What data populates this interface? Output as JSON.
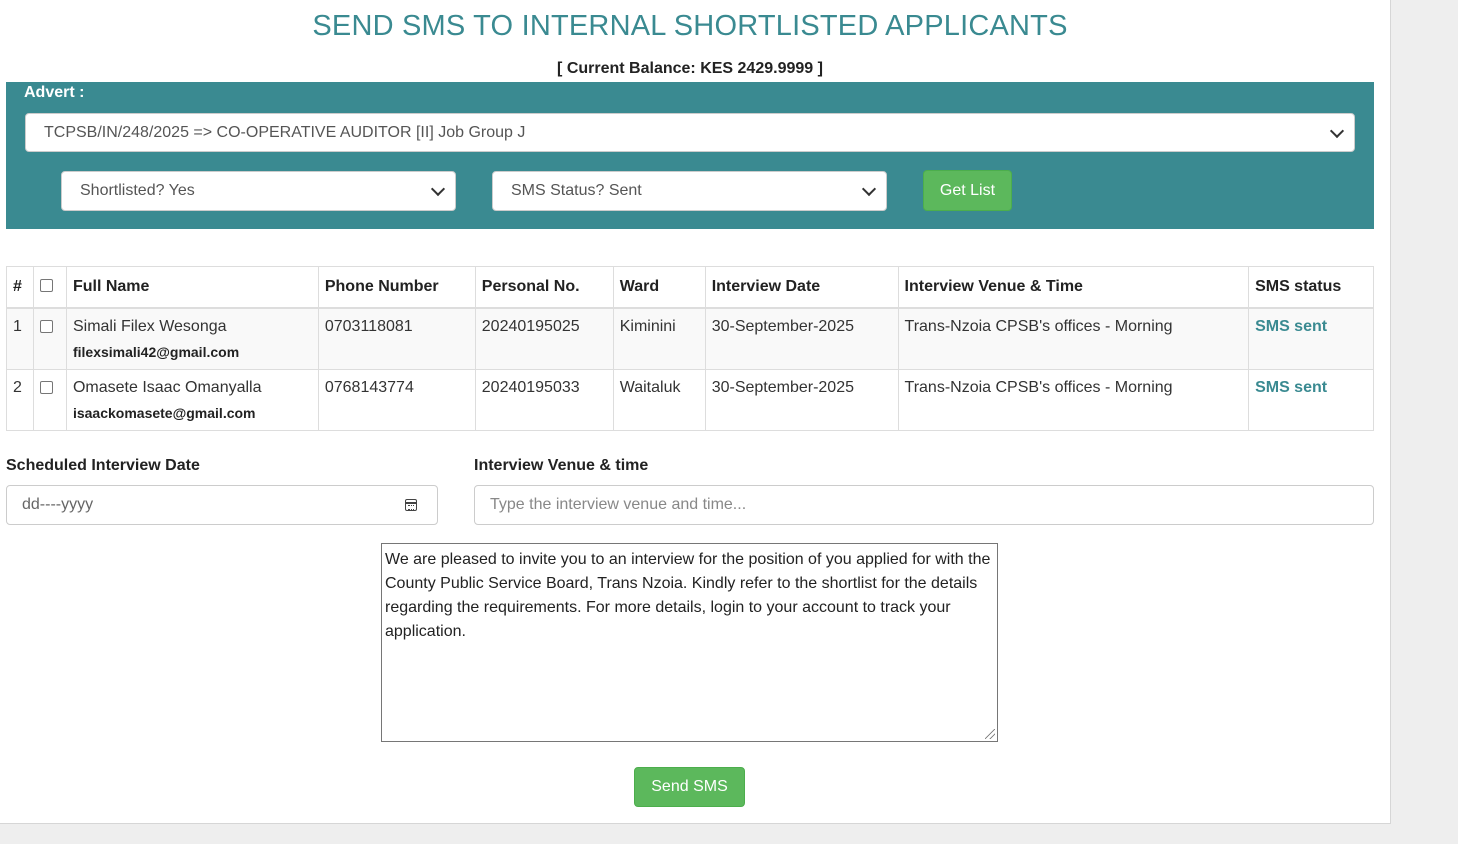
{
  "page": {
    "title": "SEND SMS TO INTERNAL SHORTLISTED APPLICANTS",
    "balance": "[ Current Balance: KES 2429.9999 ]"
  },
  "filters": {
    "advert_label": "Advert :",
    "advert_selected": "TCPSB/IN/248/2025 => CO-OPERATIVE AUDITOR [II] Job Group J",
    "shortlisted_selected": "Shortlisted? Yes",
    "sms_status_selected": "SMS Status? Sent",
    "get_list_label": "Get List"
  },
  "table": {
    "headers": [
      "#",
      "",
      "Full Name",
      "Phone Number",
      "Personal No.",
      "Ward",
      "Interview Date",
      "Interview Venue & Time",
      "SMS status"
    ],
    "rows": [
      {
        "num": "1",
        "name": "Simali Filex Wesonga",
        "email": "filexsimali42@gmail.com",
        "phone": "0703118081",
        "personal_no": "20240195025",
        "ward": "Kiminini",
        "interview_date": "30-September-2025",
        "venue": "Trans-Nzoia CPSB's offices - Morning",
        "sms_status": "SMS sent"
      },
      {
        "num": "2",
        "name": "Omasete Isaac Omanyalla",
        "email": "isaackomasete@gmail.com",
        "phone": "0768143774",
        "personal_no": "20240195033",
        "ward": "Waitaluk",
        "interview_date": "30-September-2025",
        "venue": "Trans-Nzoia CPSB's offices - Morning",
        "sms_status": "SMS sent"
      }
    ]
  },
  "form": {
    "date_label": "Scheduled Interview Date",
    "date_placeholder": "dd----yyyy",
    "venue_label": "Interview Venue & time",
    "venue_placeholder": "Type the interview venue and time...",
    "message": "We are pleased to invite you to an interview for the position of  you applied for with the County Public Service Board, Trans Nzoia. Kindly refer to the shortlist for the details regarding the requirements. For more details, login to your account to track your application.",
    "send_label": "Send SMS"
  },
  "colors": {
    "accent": "#3a8a91",
    "button_green": "#5cb85c"
  }
}
